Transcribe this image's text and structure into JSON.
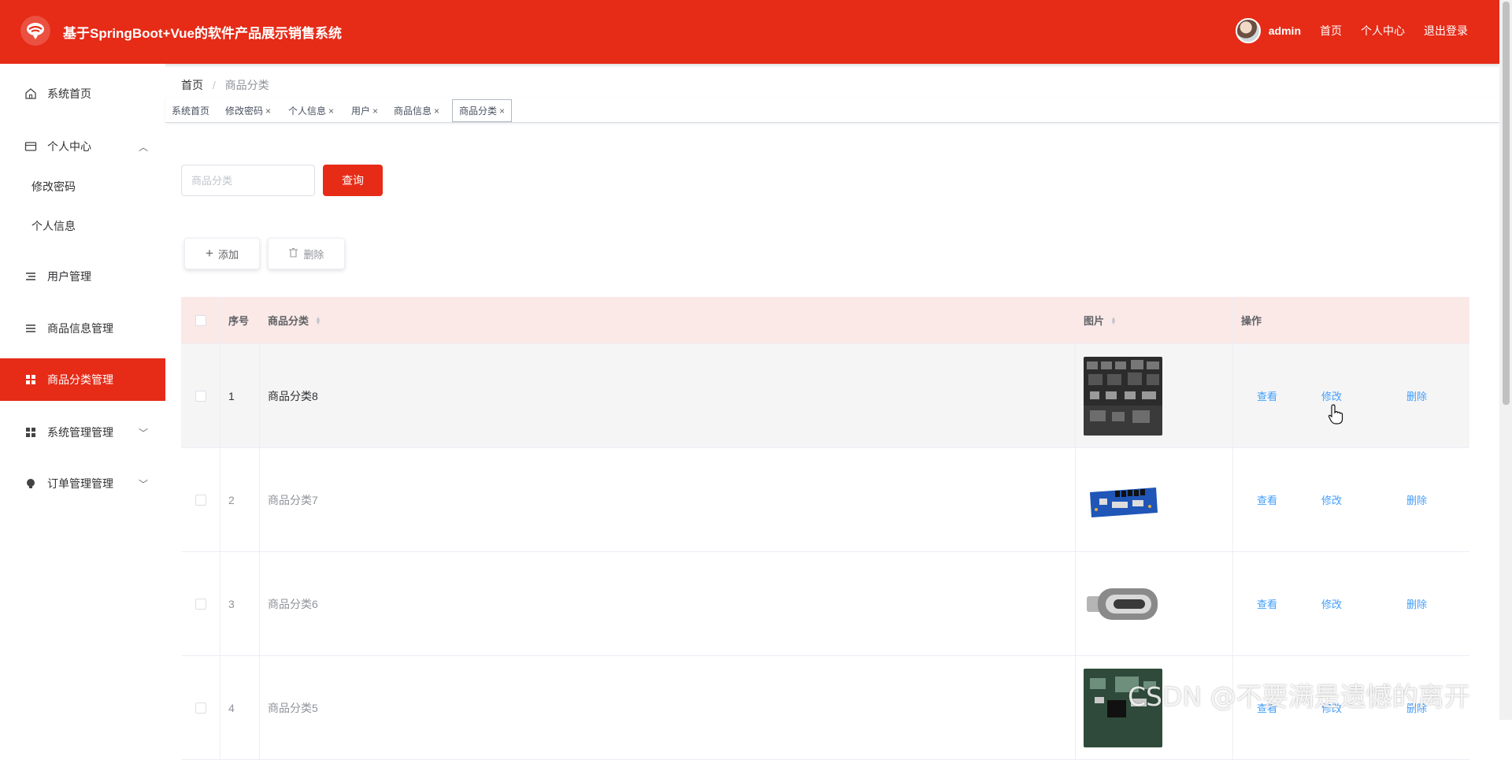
{
  "header": {
    "title": "基于SpringBoot+Vue的软件产品展示销售系统",
    "username": "admin",
    "links": [
      "首页",
      "个人中心",
      "退出登录"
    ]
  },
  "sidebar": {
    "home": "系统首页",
    "personal_center": "个人中心",
    "sub_change_password": "修改密码",
    "sub_personal_info": "个人信息",
    "user_mgmt": "用户管理",
    "product_info_mgmt": "商品信息管理",
    "product_category_mgmt": "商品分类管理",
    "system_mgmt": "系统管理管理",
    "order_mgmt": "订单管理管理"
  },
  "breadcrumb": {
    "home": "首页",
    "sep": "/",
    "current": "商品分类"
  },
  "tabs": [
    "系统首页",
    "修改密码",
    "个人信息",
    "用户",
    "商品信息",
    "商品分类"
  ],
  "search": {
    "placeholder": "商品分类",
    "button": "查询"
  },
  "toolbar": {
    "add": "添加",
    "delete": "删除"
  },
  "table": {
    "headers": {
      "index": "序号",
      "category": "商品分类",
      "image": "图片",
      "actions": "操作"
    },
    "actions": {
      "view": "查看",
      "edit": "修改",
      "delete": "删除"
    },
    "rows": [
      {
        "index": "1",
        "category": "商品分类8"
      },
      {
        "index": "2",
        "category": "商品分类7"
      },
      {
        "index": "3",
        "category": "商品分类6"
      },
      {
        "index": "4",
        "category": "商品分类5"
      }
    ]
  },
  "watermark": "CSDN @不要满是遗憾的离开",
  "colors": {
    "accent": "#e62b17",
    "link": "#409eff",
    "header_row": "#fbe9e8"
  }
}
